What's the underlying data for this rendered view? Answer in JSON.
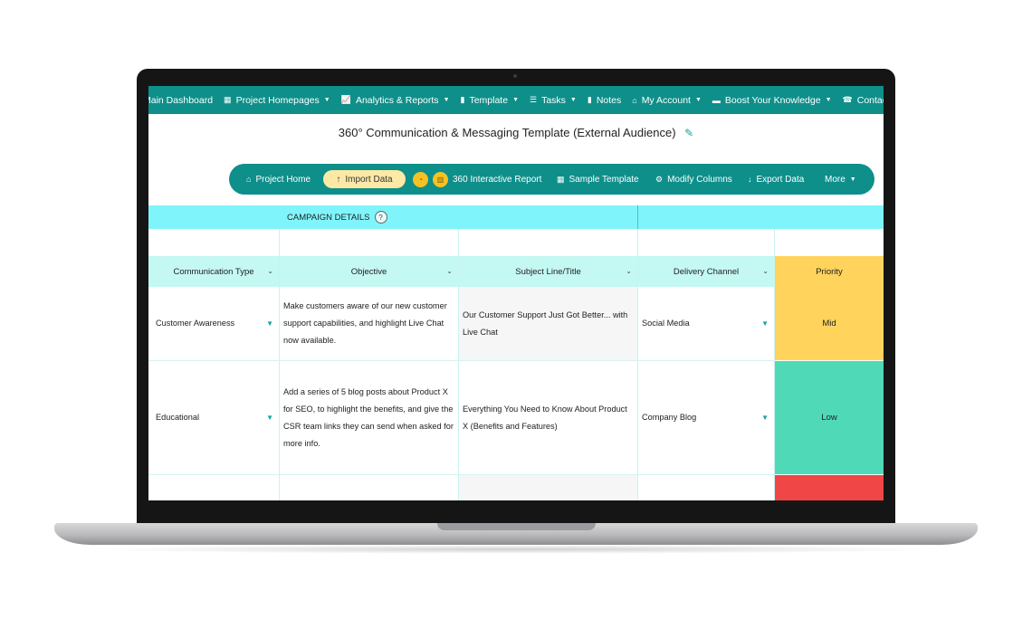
{
  "topnav": {
    "items": [
      {
        "label": "Main Dashboard",
        "icon": "",
        "caret": ""
      },
      {
        "label": "Project Homepages",
        "icon": "▦",
        "caret": "▼"
      },
      {
        "label": "Analytics & Reports",
        "icon": "📈",
        "caret": "▼"
      },
      {
        "label": "Template",
        "icon": "▮",
        "caret": "▼"
      },
      {
        "label": "Tasks",
        "icon": "☰",
        "caret": "▼"
      },
      {
        "label": "Notes",
        "icon": "▮",
        "caret": ""
      },
      {
        "label": "My Account",
        "icon": "⌂",
        "caret": "▼"
      },
      {
        "label": "Boost Your Knowledge",
        "icon": "▬",
        "caret": "▼"
      },
      {
        "label": "Contact",
        "icon": "☎",
        "caret": ""
      }
    ]
  },
  "page": {
    "title": "360° Communication & Messaging Template (External Audience)",
    "edit_icon": "✎"
  },
  "toolbar": {
    "project_home": "Project Home",
    "import_data": "Import Data",
    "interactive_report": "360 Interactive Report",
    "sample_template": "Sample Template",
    "modify_columns": "Modify Columns",
    "export_data": "Export Data",
    "more": "More",
    "icons": {
      "home": "⌂",
      "import": "↑",
      "report1": "◔",
      "report2": "▥",
      "grid": "▦",
      "gear": "⚙",
      "download": "↓",
      "caret": "▼"
    }
  },
  "section": {
    "label": "CAMPAIGN DETAILS",
    "help": "?"
  },
  "table": {
    "headers": {
      "communication_type": "Communication Type",
      "objective": "Objective",
      "subject_line": "Subject Line/Title",
      "delivery_channel": "Delivery Channel",
      "priority": "Priority"
    },
    "chevron": "⌄",
    "dropdown": "▼",
    "rows": [
      {
        "communication_type": "Customer Awareness",
        "objective": "Make customers aware of our new customer support capabilities, and highlight Live Chat now available.",
        "subject_line": "Our Customer Support Just Got Better... with Live Chat",
        "delivery_channel": "Social Media",
        "priority": "Mid",
        "priority_color": "#ffd35c"
      },
      {
        "communication_type": "Educational",
        "objective": "Add a series of 5 blog posts about Product X for SEO, to highlight the benefits, and give the CSR team links they can send when asked for more info.",
        "subject_line": "Everything You Need to Know About Product X (Benefits and Features)",
        "delivery_channel": "Company Blog",
        "priority": "Low",
        "priority_color": "#4fd9b6"
      },
      {
        "communication_type": "",
        "objective": "",
        "subject_line": "",
        "delivery_channel": "",
        "priority": "",
        "priority_color": "#f04646"
      }
    ]
  },
  "colors": {
    "brand_teal": "#0e8f8a",
    "section_cyan": "#7ff5fb",
    "header_mint": "#c4f8f2",
    "import_yellow": "#fde9a6"
  }
}
